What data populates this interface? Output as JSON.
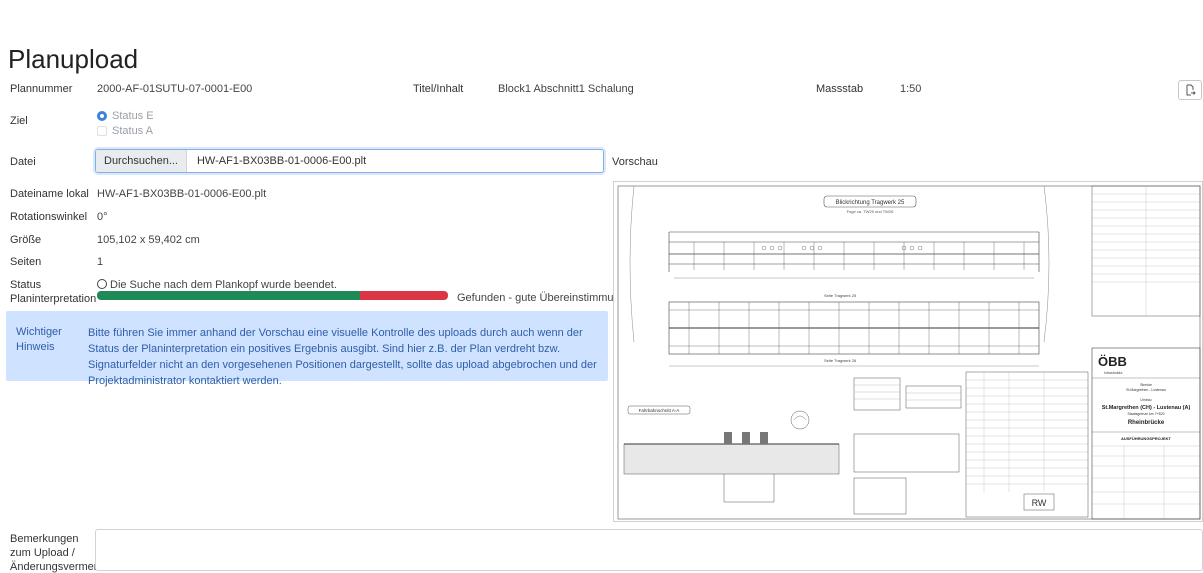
{
  "page": {
    "title": "Planupload"
  },
  "header": {
    "plannummer_label": "Plannummer",
    "plannummer_value": "2000-AF-01SUTU-07-0001-E00",
    "titel_label": "Titel/Inhalt",
    "titel_value": "Block1 Abschnitt1 Schalung",
    "massstab_label": "Massstab",
    "massstab_value": "1:50",
    "export_icon": "export-icon"
  },
  "ziel": {
    "label": "Ziel",
    "options": [
      {
        "label": "Status E",
        "checked": true
      },
      {
        "label": "Status A",
        "checked": false
      }
    ]
  },
  "datei": {
    "label": "Datei",
    "browse_label": "Durchsuchen...",
    "file_value": "HW-AF1-BX03BB-01-0006-E00.plt"
  },
  "vorschau": {
    "label": "Vorschau"
  },
  "details": {
    "dateiname_label": "Dateiname lokal",
    "dateiname_value": "HW-AF1-BX03BB-01-0006-E00.plt",
    "rotation_label": "Rotationswinkel",
    "rotation_value": "0°",
    "groesse_label": "Größe",
    "groesse_value": "105,102 x 59,402 cm",
    "seiten_label": "Seiten",
    "seiten_value": "1"
  },
  "status": {
    "label_line1": "Status",
    "label_line2": "Planinterpretation",
    "message": "Die Suche nach dem Plankopf wurde beendet.",
    "progress_good_fraction": 0.75,
    "progress_bad_fraction": 0.25,
    "result_text": "Gefunden - gute Übereinstimmung",
    "colors": {
      "good": "#1f8a57",
      "bad": "#dc3545"
    }
  },
  "hinweis": {
    "title": "Wichtiger Hinweis",
    "text": "Bitte führen Sie immer anhand der Vorschau eine visuelle Kontrolle des uploads durch auch wenn der Status der Planinterpretation ein positives Ergebnis ausgibt. Sind hier z.B. der Plan verdreht bzw. Signaturfelder nicht an den vorgesehenen Positionen dargestellt, sollte das upload abgebrochen und der Projektadministrator kontaktiert werden."
  },
  "preview": {
    "drawing_title": "Blickrichtung Tragwerk 25",
    "drawing_subtitle": "Fuge ca. TW25 und TW26",
    "section_top": "Seite Tragwerk 25",
    "section_bottom": "Seite Tragwerk 26",
    "detail_title": "Fahrbahnschnitt A-A",
    "logo_text": "ÖBB",
    "logo_sub": "Infrastruktur",
    "project_line1": "Strecke",
    "project_line2": "St.Margrethen - Lustenau",
    "project_line3": "Umbau",
    "project_main": "St.Margrethen (CH) - Lustenau (A)",
    "project_km": "Staatsgrenze km 7+820",
    "project_name": "Rheinbrücke",
    "project_phase": "AUSFÜHRUNGSPROJEKT",
    "stamp_text": "RW"
  },
  "remarks": {
    "label": "Bemerkungen zum Upload / Änderungsvermerke"
  }
}
